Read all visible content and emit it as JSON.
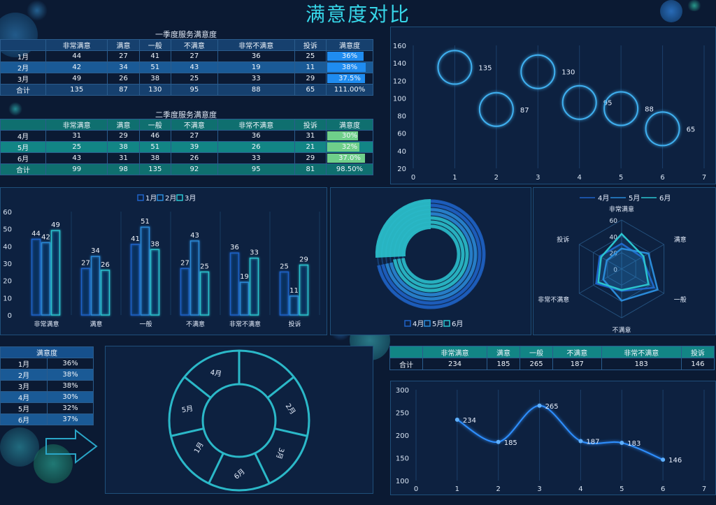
{
  "title": "满意度对比",
  "colors": {
    "bg": "#0b1a33",
    "q1_header": "#16406e",
    "q1_row_alt": "#1a5a96",
    "q2_header": "#0f6f6f",
    "q2_row_alt": "#128585",
    "cyan": "#37d6e8",
    "blue": "#2f8fff",
    "green": "#6fd68a"
  },
  "q1_table": {
    "caption": "一季度服务满意度",
    "headers": [
      "",
      "非常满意",
      "满意",
      "一般",
      "不满意",
      "非常不满意",
      "投诉",
      "满意度"
    ],
    "rows": [
      {
        "label": "1月",
        "cells": [
          "44",
          "27",
          "41",
          "27",
          "36",
          "25"
        ],
        "rate": "36%",
        "rate_value": 0.36
      },
      {
        "label": "2月",
        "cells": [
          "42",
          "34",
          "51",
          "43",
          "19",
          "11"
        ],
        "rate": "38%",
        "rate_value": 0.38
      },
      {
        "label": "3月",
        "cells": [
          "49",
          "26",
          "38",
          "25",
          "33",
          "29"
        ],
        "rate": "37.5%",
        "rate_value": 0.375
      }
    ],
    "total": {
      "label": "合计",
      "cells": [
        "135",
        "87",
        "130",
        "95",
        "88",
        "65"
      ],
      "rate": "111.00%"
    }
  },
  "q2_table": {
    "caption": "二季度服务满意度",
    "headers": [
      "",
      "非常满意",
      "满意",
      "一般",
      "不满意",
      "非常不满意",
      "投诉",
      "满意度"
    ],
    "rows": [
      {
        "label": "4月",
        "cells": [
          "31",
          "29",
          "46",
          "27",
          "36",
          "31"
        ],
        "rate": "30%",
        "rate_value": 0.3
      },
      {
        "label": "5月",
        "cells": [
          "25",
          "38",
          "51",
          "39",
          "26",
          "21"
        ],
        "rate": "32%",
        "rate_value": 0.32
      },
      {
        "label": "6月",
        "cells": [
          "43",
          "31",
          "38",
          "26",
          "33",
          "29"
        ],
        "rate": "37.0%",
        "rate_value": 0.37
      }
    ],
    "total": {
      "label": "合计",
      "cells": [
        "99",
        "98",
        "135",
        "92",
        "95",
        "81"
      ],
      "rate": "98.50%"
    }
  },
  "sat_table": {
    "header": "满意度",
    "rows": [
      {
        "label": "1月",
        "value": "36%"
      },
      {
        "label": "2月",
        "value": "38%"
      },
      {
        "label": "3月",
        "value": "38%"
      },
      {
        "label": "4月",
        "value": "30%"
      },
      {
        "label": "5月",
        "value": "32%"
      },
      {
        "label": "6月",
        "value": "37%"
      }
    ]
  },
  "total_table": {
    "headers": [
      "",
      "非常满意",
      "满意",
      "一般",
      "不满意",
      "非常不满意",
      "投诉"
    ],
    "row": {
      "label": "合计",
      "cells": [
        "234",
        "185",
        "265",
        "187",
        "183",
        "146"
      ]
    }
  },
  "chart_data": [
    {
      "type": "scatter",
      "x": [
        1,
        2,
        3,
        4,
        5,
        6
      ],
      "y": [
        135,
        87,
        130,
        95,
        88,
        65
      ],
      "labels": [
        "135",
        "87",
        "130",
        "95",
        "88",
        "65"
      ],
      "xlim": [
        0,
        7
      ],
      "ylim": [
        20,
        160
      ],
      "xticks": [
        "0",
        "1",
        "2",
        "3",
        "4",
        "5",
        "6",
        "7"
      ],
      "yticks": [
        "20",
        "40",
        "60",
        "80",
        "100",
        "120",
        "140",
        "160"
      ],
      "grid": "vertical"
    },
    {
      "type": "bar",
      "categories": [
        "非常满意",
        "满意",
        "一般",
        "不满意",
        "非常不满意",
        "投诉"
      ],
      "series": [
        {
          "name": "1月",
          "values": [
            44,
            27,
            41,
            27,
            36,
            25
          ],
          "color": "#1e63c8"
        },
        {
          "name": "2月",
          "values": [
            42,
            34,
            51,
            43,
            19,
            11
          ],
          "color": "#2a8ad8"
        },
        {
          "name": "3月",
          "values": [
            49,
            26,
            38,
            25,
            33,
            29
          ],
          "color": "#2bc4cf"
        }
      ],
      "ylim": [
        0,
        60
      ],
      "yticks": [
        "0",
        "10",
        "20",
        "30",
        "40",
        "50",
        "60"
      ],
      "legend": "top-center"
    },
    {
      "type": "pie",
      "variant": "radial-bar",
      "series": [
        {
          "name": "4月",
          "color": "#1e63c8"
        },
        {
          "name": "5月",
          "color": "#2a8ad8"
        },
        {
          "name": "6月",
          "color": "#2bc4cf"
        }
      ],
      "legend": "bottom"
    },
    {
      "type": "radar",
      "axes": [
        "非常满意",
        "满意",
        "一般",
        "不满意",
        "非常不满意",
        "投诉"
      ],
      "series": [
        {
          "name": "4月",
          "values": [
            31,
            29,
            46,
            27,
            36,
            31
          ],
          "color": "#1e63c8"
        },
        {
          "name": "5月",
          "values": [
            25,
            38,
            51,
            39,
            26,
            21
          ],
          "color": "#2a8ad8"
        },
        {
          "name": "6月",
          "values": [
            43,
            31,
            38,
            26,
            33,
            29
          ],
          "color": "#2bc4cf"
        }
      ],
      "rlim": [
        0,
        60
      ],
      "rticks": [
        "0",
        "20",
        "40",
        "60"
      ],
      "legend": "top"
    },
    {
      "type": "pie",
      "variant": "ring-segments",
      "labels": [
        "2月",
        "3月",
        "6月",
        "1月",
        "5月",
        "4月"
      ]
    },
    {
      "type": "line",
      "x": [
        1,
        2,
        3,
        4,
        5,
        6
      ],
      "y": [
        234,
        185,
        265,
        187,
        183,
        146
      ],
      "labels": [
        "234",
        "185",
        "265",
        "187",
        "183",
        "146"
      ],
      "xlim": [
        0,
        7
      ],
      "ylim": [
        100,
        300
      ],
      "xticks": [
        "0",
        "1",
        "2",
        "3",
        "4",
        "5",
        "6",
        "7"
      ],
      "yticks": [
        "100",
        "150",
        "200",
        "250",
        "300"
      ],
      "smooth": true,
      "grid": "vertical"
    }
  ]
}
